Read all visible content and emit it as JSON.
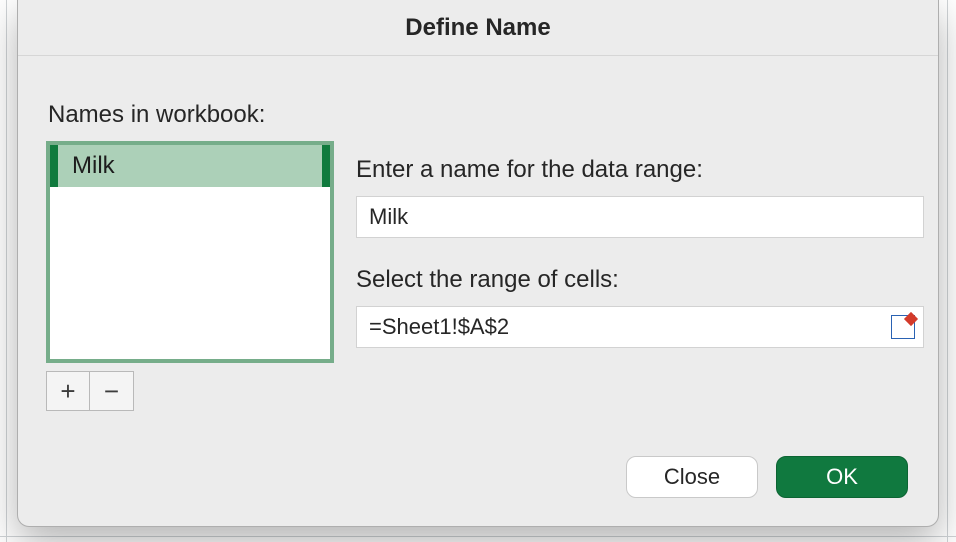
{
  "dialog": {
    "title": "Define Name",
    "names_label": "Names in workbook:",
    "list": {
      "items": [
        "Milk"
      ]
    },
    "add_label": "+",
    "remove_label": "−",
    "name_field_label": "Enter a name for the data range:",
    "name_field_value": "Milk",
    "range_field_label": "Select the range of cells:",
    "range_field_value": "=Sheet1!$A$2",
    "close_label": "Close",
    "ok_label": "OK"
  }
}
